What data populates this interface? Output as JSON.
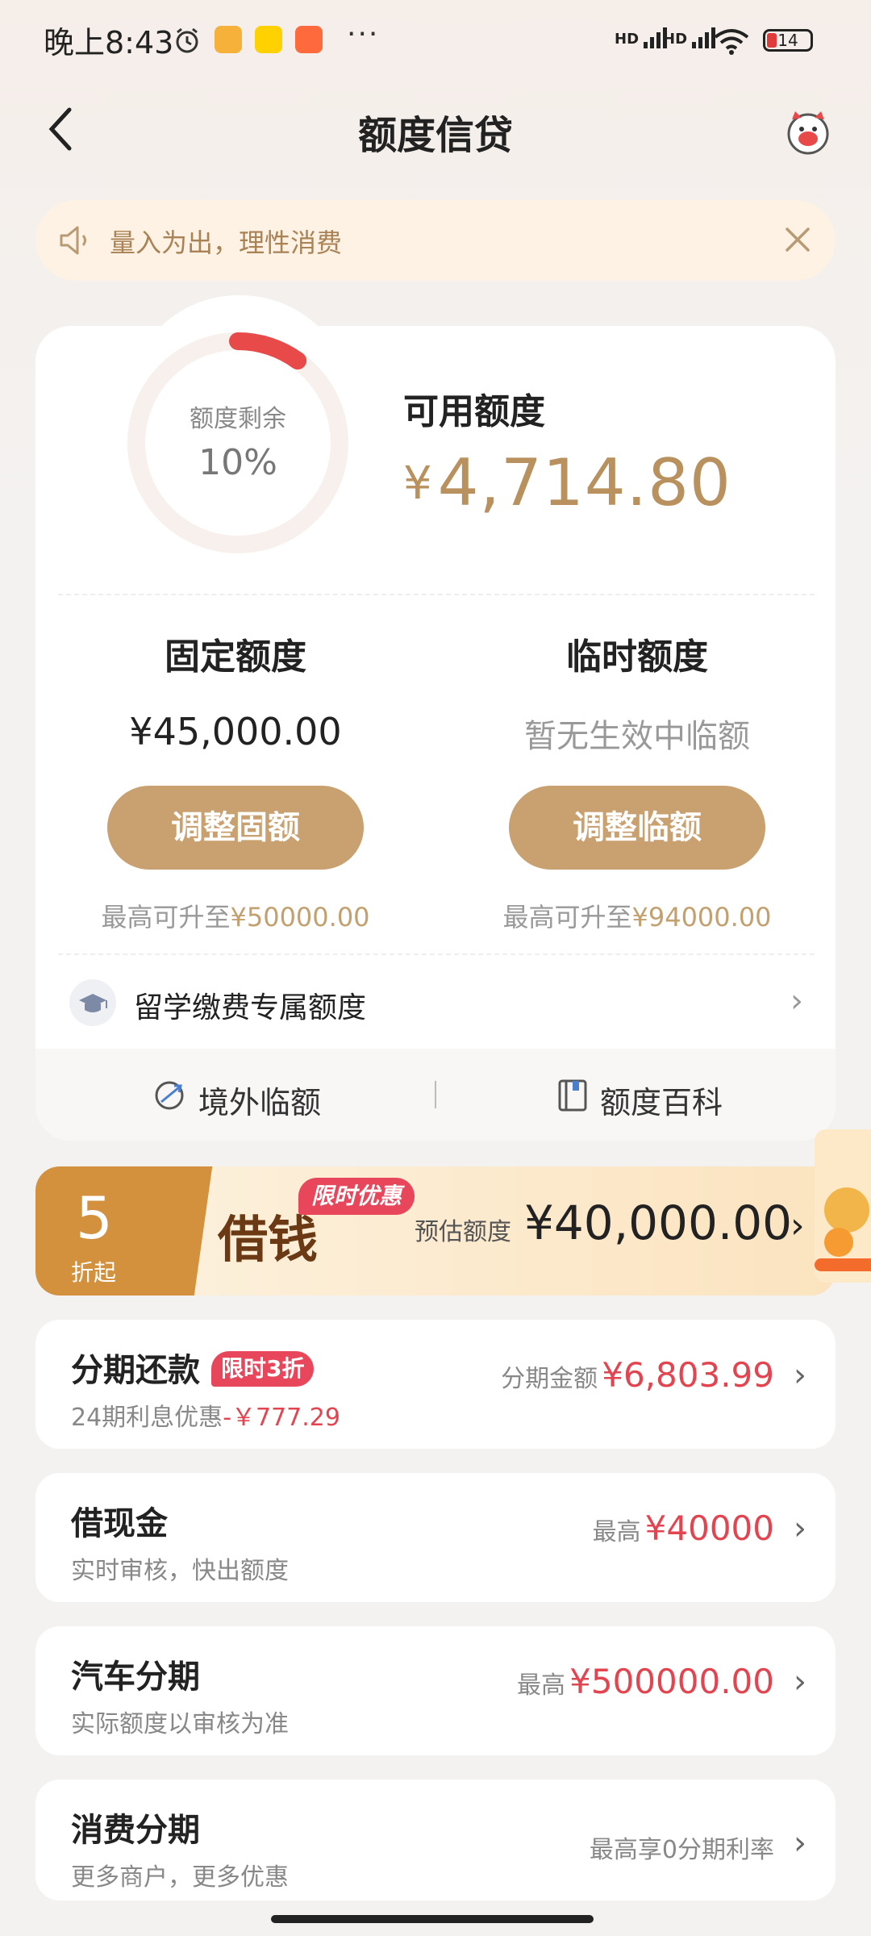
{
  "status_bar": {
    "time": "晚上8:43",
    "network1": "HD",
    "network2": "HD",
    "battery": "14",
    "overflow": "···"
  },
  "header": {
    "title": "额度信贷"
  },
  "notice": {
    "text": "量入为出，理性消费"
  },
  "credit": {
    "ring_label": "额度剩余",
    "ring_percent": "10%",
    "ring_fraction": 0.1,
    "available_label": "可用额度",
    "available_currency": "¥",
    "available_value": "4,714.80",
    "fixed": {
      "title": "固定额度",
      "value": "¥45,000.00",
      "button": "调整固额",
      "note_prefix": "最高可升至",
      "note_value": "¥50000.00"
    },
    "temp": {
      "title": "临时额度",
      "value": "暂无生效中临额",
      "button": "调整临额",
      "note_prefix": "最高可升至",
      "note_value": "¥94000.00"
    },
    "study": {
      "label": "留学缴费专属额度"
    },
    "footer": {
      "overseas": "境外临额",
      "wiki": "额度百科"
    }
  },
  "loan_banner": {
    "discount": "5",
    "discount_sub": "折起",
    "title": "借钱",
    "promo": "限时优惠",
    "estimate_label": "预估额度",
    "estimate_value": "¥40,000.00"
  },
  "list": [
    {
      "title": "分期还款",
      "tag": "限时3折",
      "sub_prefix": "24期利息优惠",
      "sub_value": "-￥777.29",
      "right_label": "分期金额",
      "right_value": "¥6,803.99"
    },
    {
      "title": "借现金",
      "sub_prefix": "实时审核，快出额度",
      "right_label": "最高",
      "right_value": "¥40000"
    },
    {
      "title": "汽车分期",
      "sub_prefix": "实际额度以审核为准",
      "right_label": "最高",
      "right_value": "¥500000.00"
    },
    {
      "title": "消费分期",
      "sub_prefix": "更多商户，更多优惠",
      "right_label": "最高享0分期利率",
      "right_value": ""
    }
  ],
  "colors": {
    "accent": "#c9a06f",
    "gold_text": "#b8915e",
    "red": "#e34550",
    "ring_red": "#e84a4a"
  }
}
